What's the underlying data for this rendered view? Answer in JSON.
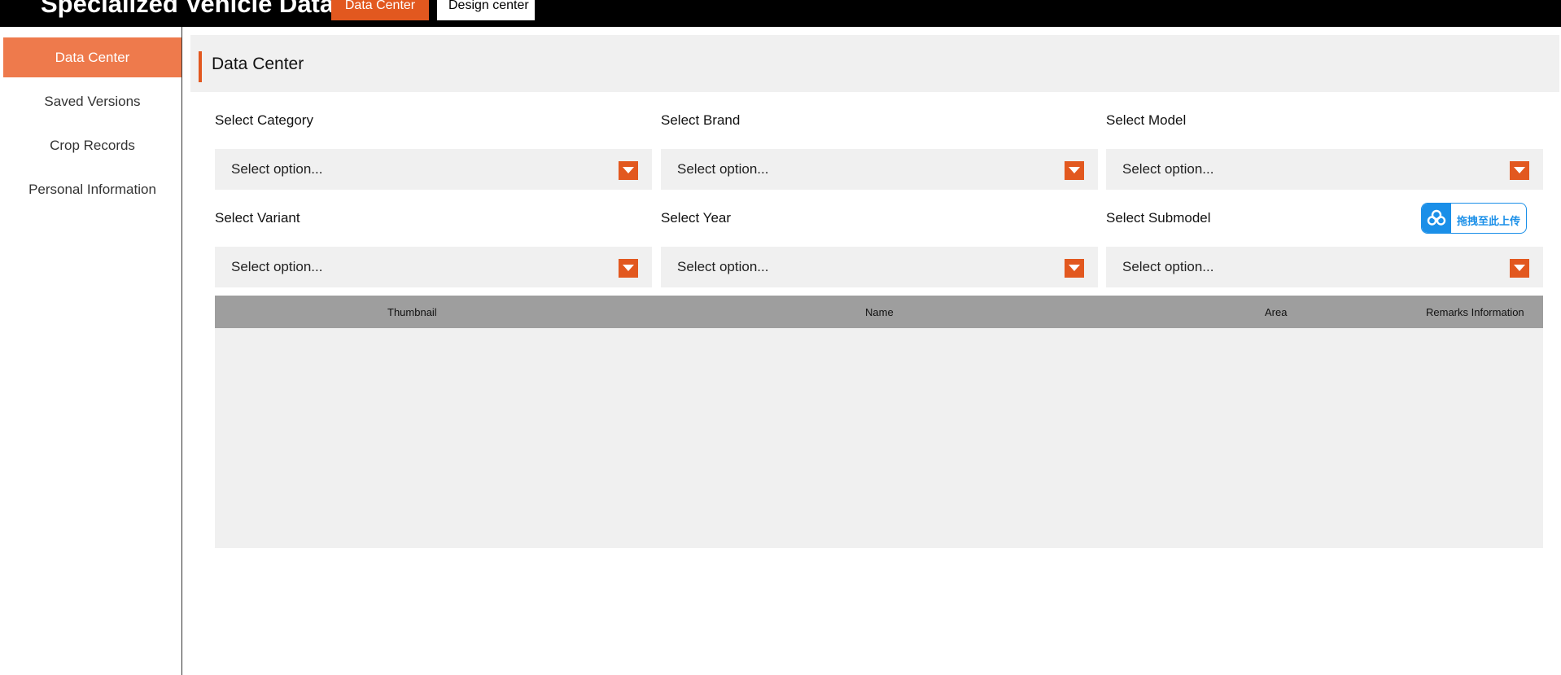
{
  "app": {
    "title": "Specialized Vehicle Data"
  },
  "top_tabs": [
    {
      "label": "Data Center",
      "active": true
    },
    {
      "label": "Design center",
      "active": false
    }
  ],
  "sidebar": {
    "items": [
      {
        "label": "Data Center",
        "active": true
      },
      {
        "label": "Saved Versions",
        "active": false
      },
      {
        "label": "Crop Records",
        "active": false
      },
      {
        "label": "Personal Information",
        "active": false
      }
    ]
  },
  "main": {
    "title": "Data Center",
    "filters": [
      {
        "label": "Select Category",
        "value": "Select option..."
      },
      {
        "label": "Select Brand",
        "value": "Select option..."
      },
      {
        "label": "Select Model",
        "value": "Select option..."
      },
      {
        "label": "Select Variant",
        "value": "Select option..."
      },
      {
        "label": "Select Year",
        "value": "Select option..."
      },
      {
        "label": "Select Submodel",
        "value": "Select option..."
      }
    ],
    "upload_button": {
      "label": "拖拽至此上传",
      "icon": "cloud-upload-icon"
    },
    "table": {
      "columns": [
        "Thumbnail",
        "Name",
        "Area",
        "Remarks Information"
      ],
      "rows": []
    }
  },
  "colors": {
    "accent": "#e2581f",
    "sidebar_active": "#ee7a4c",
    "topbar": "#000000",
    "panel": "#f0f0f0",
    "table_header": "#9e9e9e",
    "upload_blue": "#1a8fe8"
  }
}
